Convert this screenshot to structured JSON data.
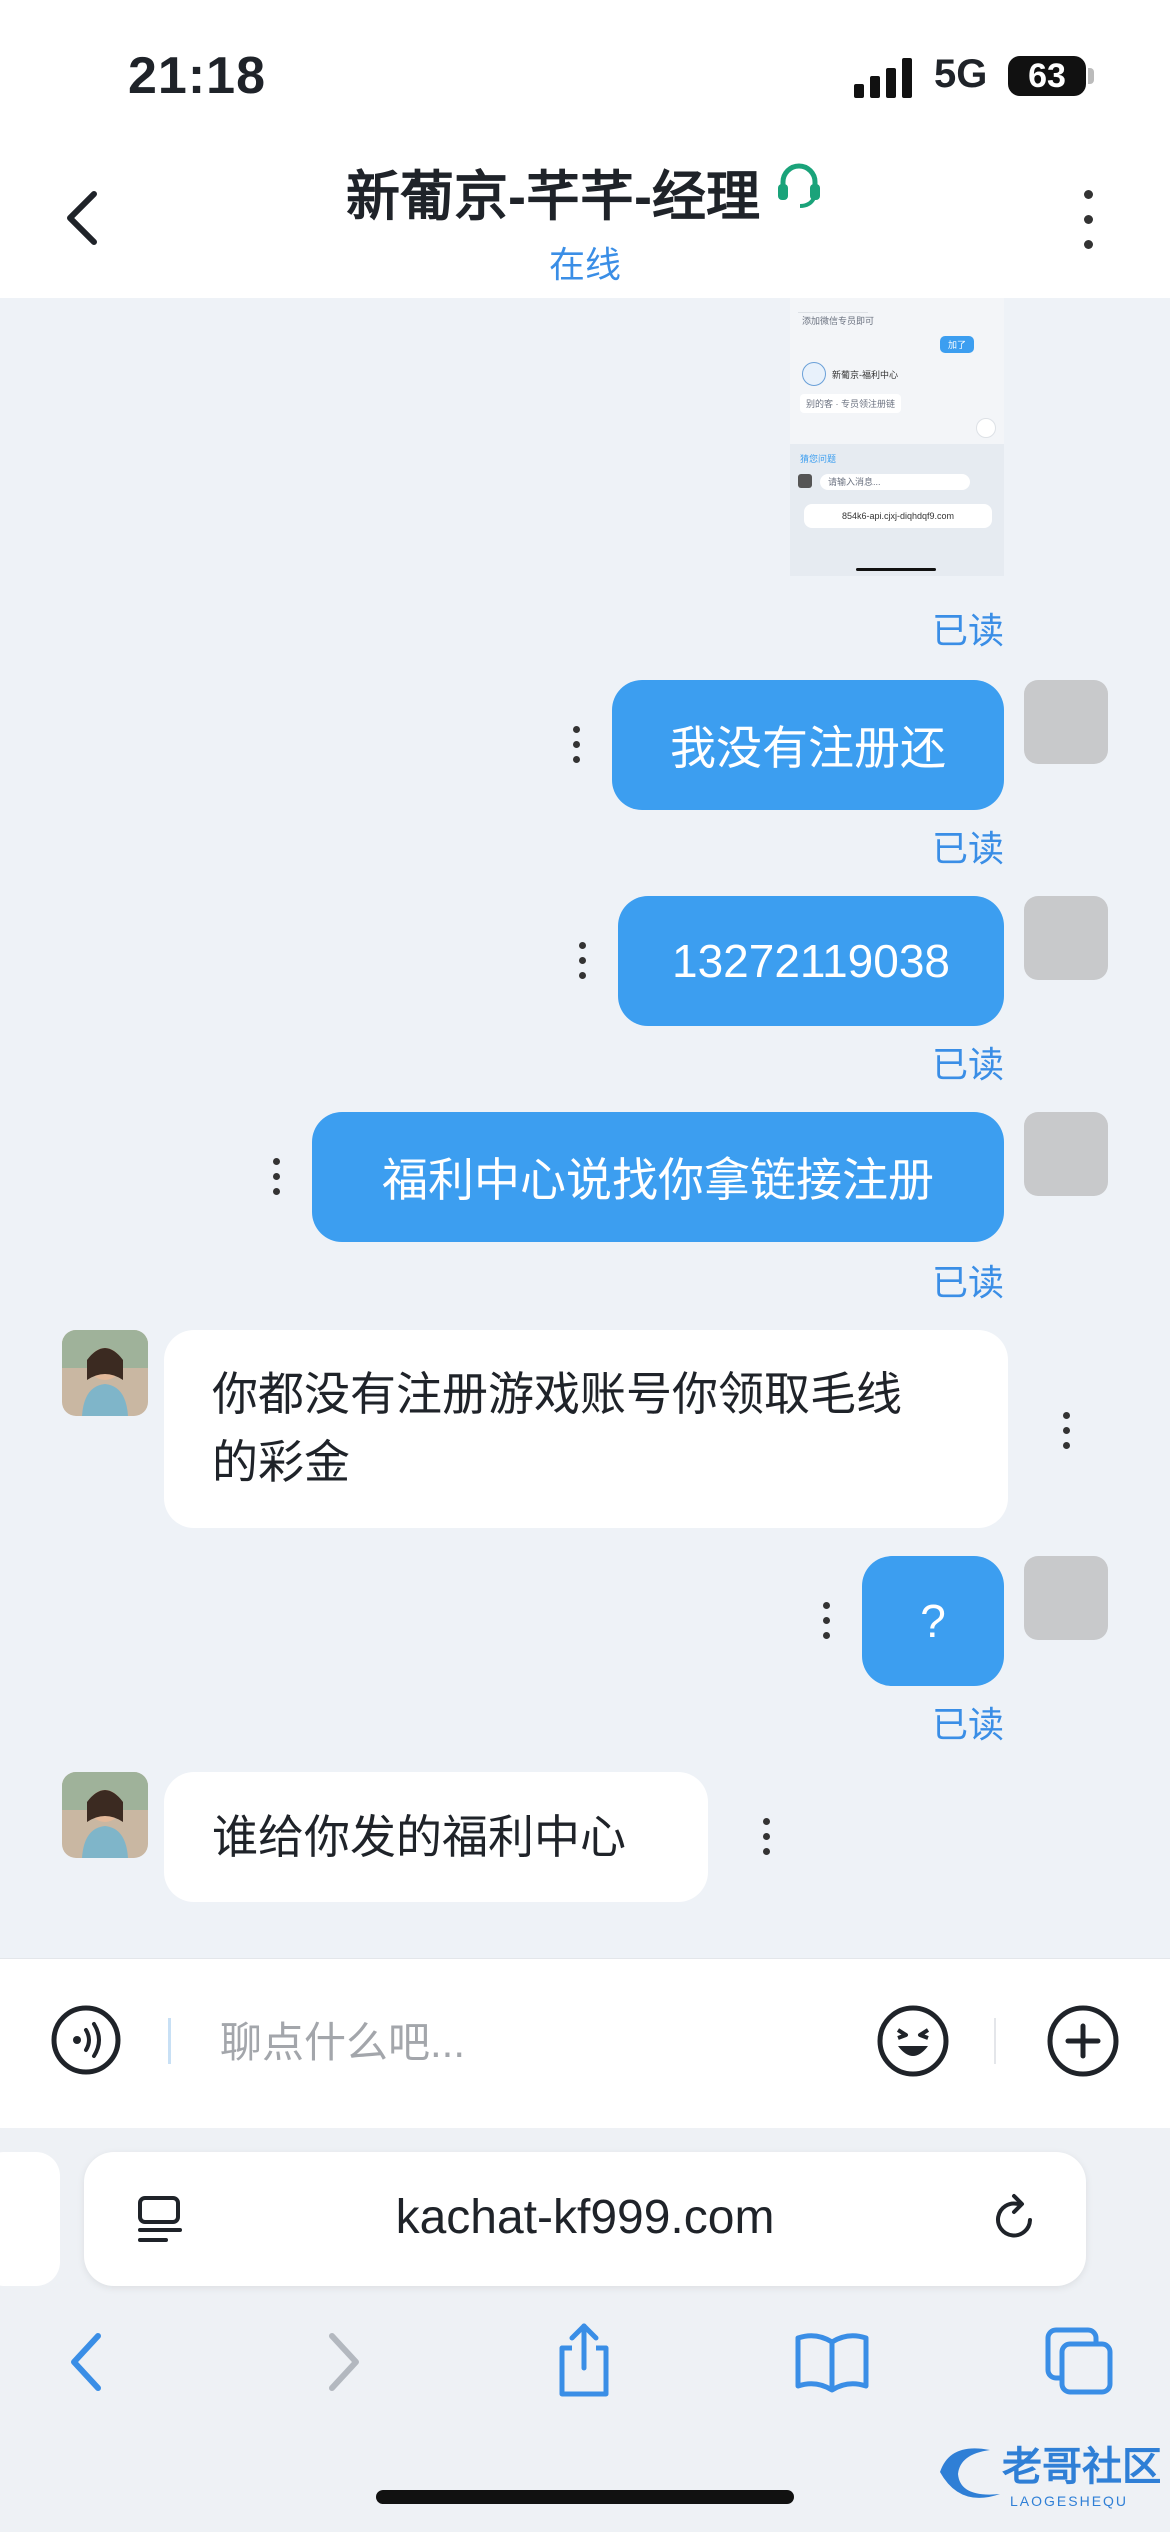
{
  "status_bar": {
    "time": "21:18",
    "network": "5G",
    "battery": "63"
  },
  "header": {
    "back_icon": "chevron-left-icon",
    "title": "新葡京-芊芊-经理",
    "title_icon": "headset-icon",
    "status": "在线",
    "more_icon": "vertical-dots-icon"
  },
  "thumbnail": {
    "line1": "添加微信专员即可",
    "btn": "加了",
    "name": "新葡京-福利中心",
    "line2": "别的客 · 专员领注册链",
    "quick": "猜您问题",
    "input_ph": "请输入消息...",
    "url": "854k6-api.cjxj-diqhdqf9.com"
  },
  "messages": [
    {
      "side": "right",
      "text": "我没有注册还",
      "read": "已读"
    },
    {
      "side": "right",
      "text": "13272119038",
      "read": "已读"
    },
    {
      "side": "right",
      "text": "福利中心说找你拿链接注册",
      "read": "已读"
    },
    {
      "side": "left",
      "text_line1": "你都没有注册游戏账号你领取毛线",
      "text_line2": "的彩金"
    },
    {
      "side": "right",
      "text": "?",
      "read": "已读"
    },
    {
      "side": "left",
      "text": "谁给你发的福利中心"
    }
  ],
  "top_read": "已读",
  "input_bar": {
    "placeholder": "聊点什么吧...",
    "voice_icon": "voice-icon",
    "emoji_icon": "emoji-icon",
    "plus_icon": "plus-icon"
  },
  "browser": {
    "url": "kachat-kf999.com",
    "reader_icon": "reader-icon",
    "reload_icon": "reload-icon"
  },
  "toolbar": {
    "back_icon": "back-icon",
    "forward_icon": "forward-icon",
    "share_icon": "share-icon",
    "bookmarks_icon": "bookmarks-icon",
    "tabs_icon": "tabs-icon"
  },
  "watermark": {
    "text": "老哥社区",
    "subtext": "LAOGESHEQU"
  },
  "colors": {
    "accent": "#3c9ef0",
    "read": "#3a8ee6",
    "headset": "#1aa37a"
  }
}
